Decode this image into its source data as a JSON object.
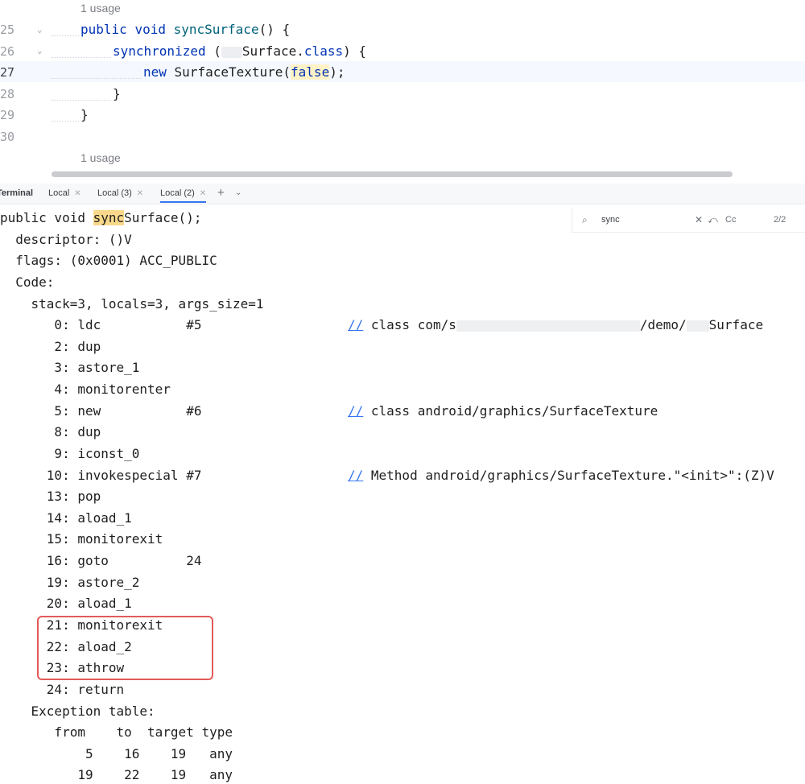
{
  "editor": {
    "usage_hint_top": "1 usage",
    "usage_hint_bottom": "1 usage",
    "line_numbers": [
      "25",
      "26",
      "27",
      "28",
      "29",
      "30"
    ],
    "line25": {
      "kw1": "public",
      "kw2": "void",
      "fn": "syncSurface",
      "rest": "() {"
    },
    "line26": {
      "kw": "synchronized",
      "open": " (",
      "cls": "Surface.",
      "kw_class": "class",
      "rest": ") {"
    },
    "line27": {
      "kw": "new",
      "type": " SurfaceTexture(",
      "arg": "false",
      "rest": ");"
    },
    "line28": {
      "text": "}"
    },
    "line29": {
      "text": "}"
    }
  },
  "tabs": {
    "title": "Terminal",
    "items": [
      {
        "label": "Local"
      },
      {
        "label": "Local (3)"
      },
      {
        "label": "Local (2)"
      }
    ],
    "plus": "+",
    "chevron": "⌄"
  },
  "find": {
    "value": "sync",
    "case_label": "Cc",
    "count": "2/2"
  },
  "terminal": {
    "sig_pre": "public void ",
    "sig_match": "sync",
    "sig_post": "Surface();",
    "descriptor": "  descriptor: ()V",
    "flags": "  flags: (0x0001) ACC_PUBLIC",
    "code": "  Code:",
    "stack": "    stack=3, locals=3, args_size=1",
    "i0": "       0: ldc           #5",
    "c0a": " class com/s",
    "c0b": "/demo/",
    "c0c": "Surface",
    "i2": "       2: dup",
    "i3": "       3: astore_1",
    "i4": "       4: monitorenter",
    "i5": "       5: new           #6",
    "c5": " class android/graphics/SurfaceTexture",
    "i8": "       8: dup",
    "i9": "       9: iconst_0",
    "i10": "      10: invokespecial #7",
    "c10": " Method android/graphics/SurfaceTexture.\"<init>\":(Z)V",
    "i13": "      13: pop",
    "i14": "      14: aload_1",
    "i15": "      15: monitorexit",
    "i16": "      16: goto          24",
    "i19": "      19: astore_2",
    "i20": "      20: aload_1",
    "i21": "      21: monitorexit",
    "i22": "      22: aload_2",
    "i23": "      23: athrow",
    "i24": "      24: return",
    "exc": "    Exception table:",
    "exc_head": "       from    to  target type",
    "exc_r1": "           5    16    19   any",
    "exc_r2": "          19    22    19   any",
    "comment_slash": "//"
  }
}
